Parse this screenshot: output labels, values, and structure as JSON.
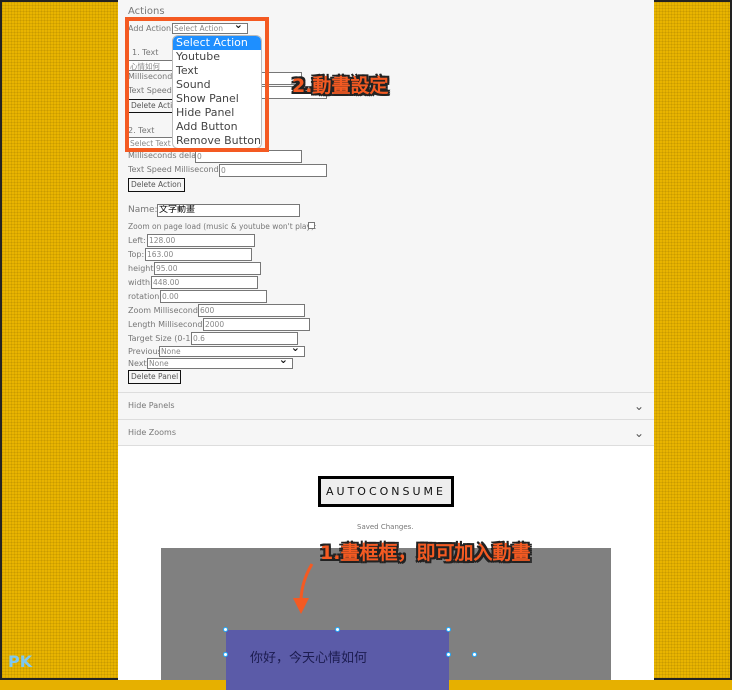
{
  "actions": {
    "title": "Actions",
    "add_action_label": "Add Action:",
    "add_action_value": "Select Action",
    "action1": {
      "heading": "1. Text",
      "text_value": "心情如何",
      "ms_delay_label": "Milliseconds delay:",
      "text_speed_label": "Text Speed Milliseconds:",
      "delete": "Delete Action"
    },
    "action2": {
      "heading": "2. Text",
      "select_value": "Select Text",
      "ms_delay_label": "Milliseconds delay:",
      "ms_delay_value": "0",
      "text_speed_label": "Text Speed Milliseconds:",
      "text_speed_value": "0",
      "delete": "Delete Action"
    },
    "dropdown_options": [
      "Select Action",
      "Youtube",
      "Text",
      "Sound",
      "Show Panel",
      "Hide Panel",
      "Add Button",
      "Remove Button"
    ]
  },
  "panel": {
    "name_label": "Name:",
    "name_value": "文字動畫",
    "zoom_load_label": "Zoom on page load (music & youtube won't play):",
    "left_label": "Left:",
    "left_value": "128.00",
    "top_label": "Top:",
    "top_value": "163.00",
    "height_label": "height:",
    "height_value": "95.00",
    "width_label": "width:",
    "width_value": "448.00",
    "rotation_label": "rotation:",
    "rotation_value": "0.00",
    "zoom_ms_label": "Zoom Milliseconds:",
    "zoom_ms_value": "600",
    "length_ms_label": "Length Milliseconds:",
    "length_ms_value": "2000",
    "target_label": "Target Size (0-1):",
    "target_value": "0.6",
    "previous_label": "Previous:",
    "previous_value": "None",
    "next_label": "Next:",
    "next_value": "None",
    "delete": "Delete Panel"
  },
  "sections": {
    "hide_panels": "Hide Panels",
    "hide_zooms": "Hide Zooms"
  },
  "brand": "AUTOCONSUME",
  "status": "Saved Changes.",
  "canvas": {
    "panel_text": "你好，今天心情如何"
  },
  "annotations": {
    "step1": "1.畫框框，即可加入動畫",
    "step2": "2.動畫設定"
  },
  "watermark": "PK"
}
